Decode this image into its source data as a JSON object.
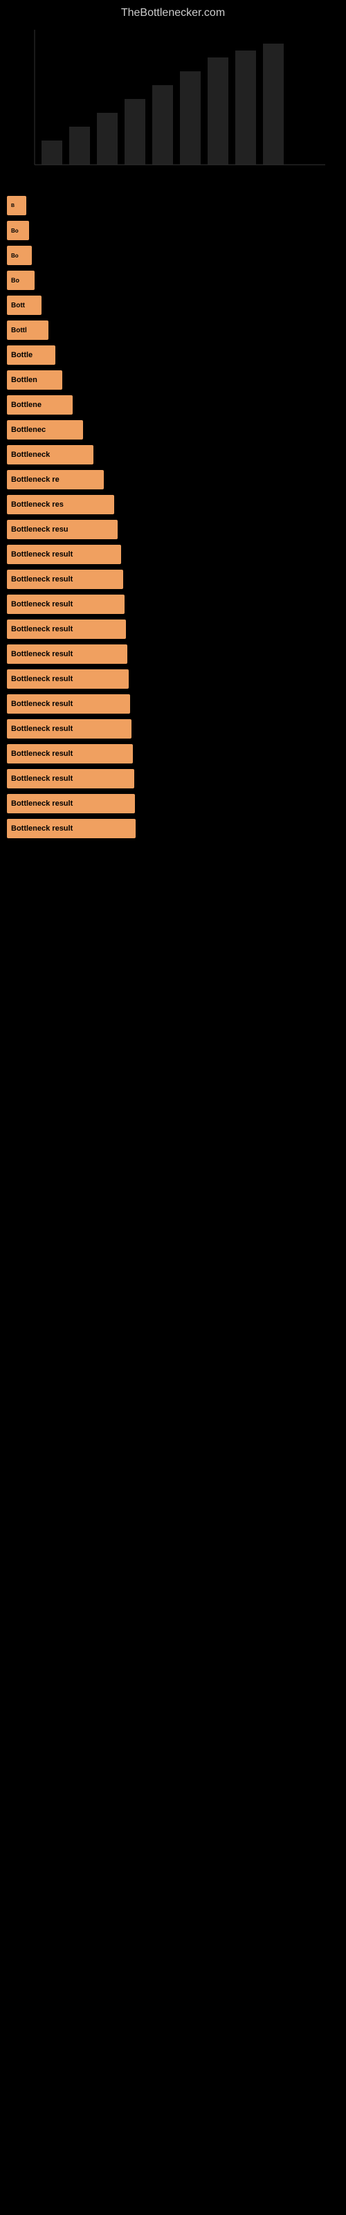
{
  "site": {
    "title": "TheBottlenecker.com"
  },
  "bars": [
    {
      "id": 1,
      "width_class": "bar-w-1",
      "text": "B",
      "text_class": "text-b"
    },
    {
      "id": 2,
      "width_class": "bar-w-2",
      "text": "Bo",
      "text_class": "text-bo"
    },
    {
      "id": 3,
      "width_class": "bar-w-3",
      "text": "Bo",
      "text_class": "text-bo"
    },
    {
      "id": 4,
      "width_class": "bar-w-4",
      "text": "Bo",
      "text_class": "text-bot"
    },
    {
      "id": 5,
      "width_class": "bar-w-5",
      "text": "Bott",
      "text_class": "text-bott"
    },
    {
      "id": 6,
      "width_class": "bar-w-6",
      "text": "Bottl",
      "text_class": "text-bottl"
    },
    {
      "id": 7,
      "width_class": "bar-w-7",
      "text": "Bottle",
      "text_class": "text-bottle"
    },
    {
      "id": 8,
      "width_class": "bar-w-8",
      "text": "Bottlen",
      "text_class": "text-bottlen"
    },
    {
      "id": 9,
      "width_class": "bar-w-9",
      "text": "Bottlene",
      "text_class": "text-bottlene"
    },
    {
      "id": 10,
      "width_class": "bar-w-10",
      "text": "Bottlenec",
      "text_class": "text-bottlenec"
    },
    {
      "id": 11,
      "width_class": "bar-w-11",
      "text": "Bottleneck",
      "text_class": "text-bottleneck"
    },
    {
      "id": 12,
      "width_class": "bar-w-12",
      "text": "Bottleneck re",
      "text_class": "text-full"
    },
    {
      "id": 13,
      "width_class": "bar-w-13",
      "text": "Bottleneck res",
      "text_class": "text-full"
    },
    {
      "id": 14,
      "width_class": "bar-w-14",
      "text": "Bottleneck resu",
      "text_class": "text-full"
    },
    {
      "id": 15,
      "width_class": "bar-w-15",
      "text": "Bottleneck result",
      "text_class": "text-full"
    },
    {
      "id": 16,
      "width_class": "bar-w-16",
      "text": "Bottleneck result",
      "text_class": "text-full"
    },
    {
      "id": 17,
      "width_class": "bar-w-17",
      "text": "Bottleneck result",
      "text_class": "text-full"
    },
    {
      "id": 18,
      "width_class": "bar-w-18",
      "text": "Bottleneck result",
      "text_class": "text-full"
    },
    {
      "id": 19,
      "width_class": "bar-w-19",
      "text": "Bottleneck result",
      "text_class": "text-full"
    },
    {
      "id": 20,
      "width_class": "bar-w-20",
      "text": "Bottleneck result",
      "text_class": "text-full"
    },
    {
      "id": 21,
      "width_class": "bar-w-21",
      "text": "Bottleneck result",
      "text_class": "text-full"
    },
    {
      "id": 22,
      "width_class": "bar-w-22",
      "text": "Bottleneck result",
      "text_class": "text-full"
    },
    {
      "id": 23,
      "width_class": "bar-w-23",
      "text": "Bottleneck result",
      "text_class": "text-full"
    },
    {
      "id": 24,
      "width_class": "bar-w-24",
      "text": "Bottleneck result",
      "text_class": "text-full"
    },
    {
      "id": 25,
      "width_class": "bar-w-25",
      "text": "Bottleneck result",
      "text_class": "text-full"
    },
    {
      "id": 26,
      "width_class": "bar-w-26",
      "text": "Bottleneck result",
      "text_class": "text-full"
    }
  ],
  "accent_color": "#f0a060"
}
